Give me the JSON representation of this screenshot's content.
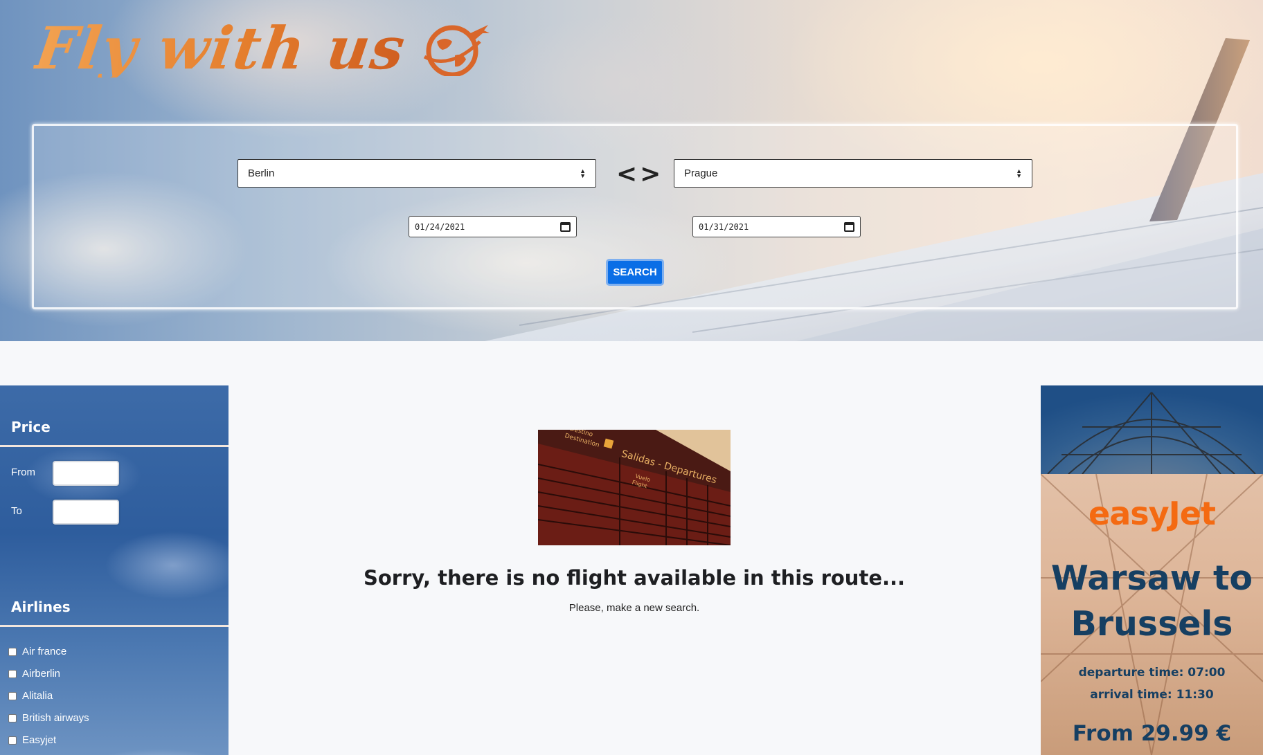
{
  "header": {
    "logo_text": "Fly with us",
    "logo_icon": "globe-plane-icon"
  },
  "search": {
    "origin": "Berlin",
    "destination": "Prague",
    "swap_label": "<>",
    "depart_date": "01/24/2021",
    "return_date": "01/31/2021",
    "search_label": "SEARCH"
  },
  "filters": {
    "price_heading": "Price",
    "from_label": "From",
    "to_label": "To",
    "airlines_heading": "Airlines",
    "airlines": [
      "Air france",
      "Airberlin",
      "Alitalia",
      "British airways",
      "Easyjet"
    ]
  },
  "results": {
    "message": "Sorry, there is no flight available in this route...",
    "sub_message": "Please, make a new search."
  },
  "ad": {
    "brand": "easyJet",
    "route_line1": "Warsaw to",
    "route_line2": "Brussels",
    "departure": "departure time: 07:00",
    "arrival": "arrival time: 11:30",
    "price": "From 29.99 €"
  },
  "colors": {
    "accent_orange": "#e57f2e",
    "search_button": "#0a6ee6",
    "ad_text": "#163f62"
  }
}
